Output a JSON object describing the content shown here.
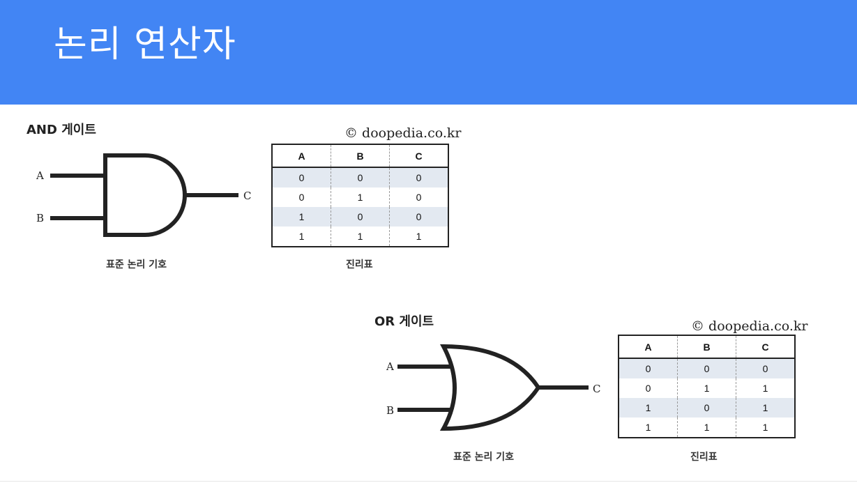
{
  "slide": {
    "title": "논리 연산자"
  },
  "and_gate": {
    "section_title": "AND 게이트",
    "copyright": "© doopedia.co.kr",
    "input_a": "A",
    "input_b": "B",
    "output": "C",
    "symbol_caption": "표준 논리 기호",
    "table_caption": "진리표",
    "table": {
      "headers": [
        "A",
        "B",
        "C"
      ],
      "rows": [
        [
          "0",
          "0",
          "0"
        ],
        [
          "0",
          "1",
          "0"
        ],
        [
          "1",
          "0",
          "0"
        ],
        [
          "1",
          "1",
          "1"
        ]
      ]
    }
  },
  "or_gate": {
    "section_title": "OR 게이트",
    "copyright": "© doopedia.co.kr",
    "input_a": "A",
    "input_b": "B",
    "output": "C",
    "symbol_caption": "표준 논리 기호",
    "table_caption": "진리표",
    "table": {
      "headers": [
        "A",
        "B",
        "C"
      ],
      "rows": [
        [
          "0",
          "0",
          "0"
        ],
        [
          "0",
          "1",
          "1"
        ],
        [
          "1",
          "0",
          "1"
        ],
        [
          "1",
          "1",
          "1"
        ]
      ]
    }
  }
}
